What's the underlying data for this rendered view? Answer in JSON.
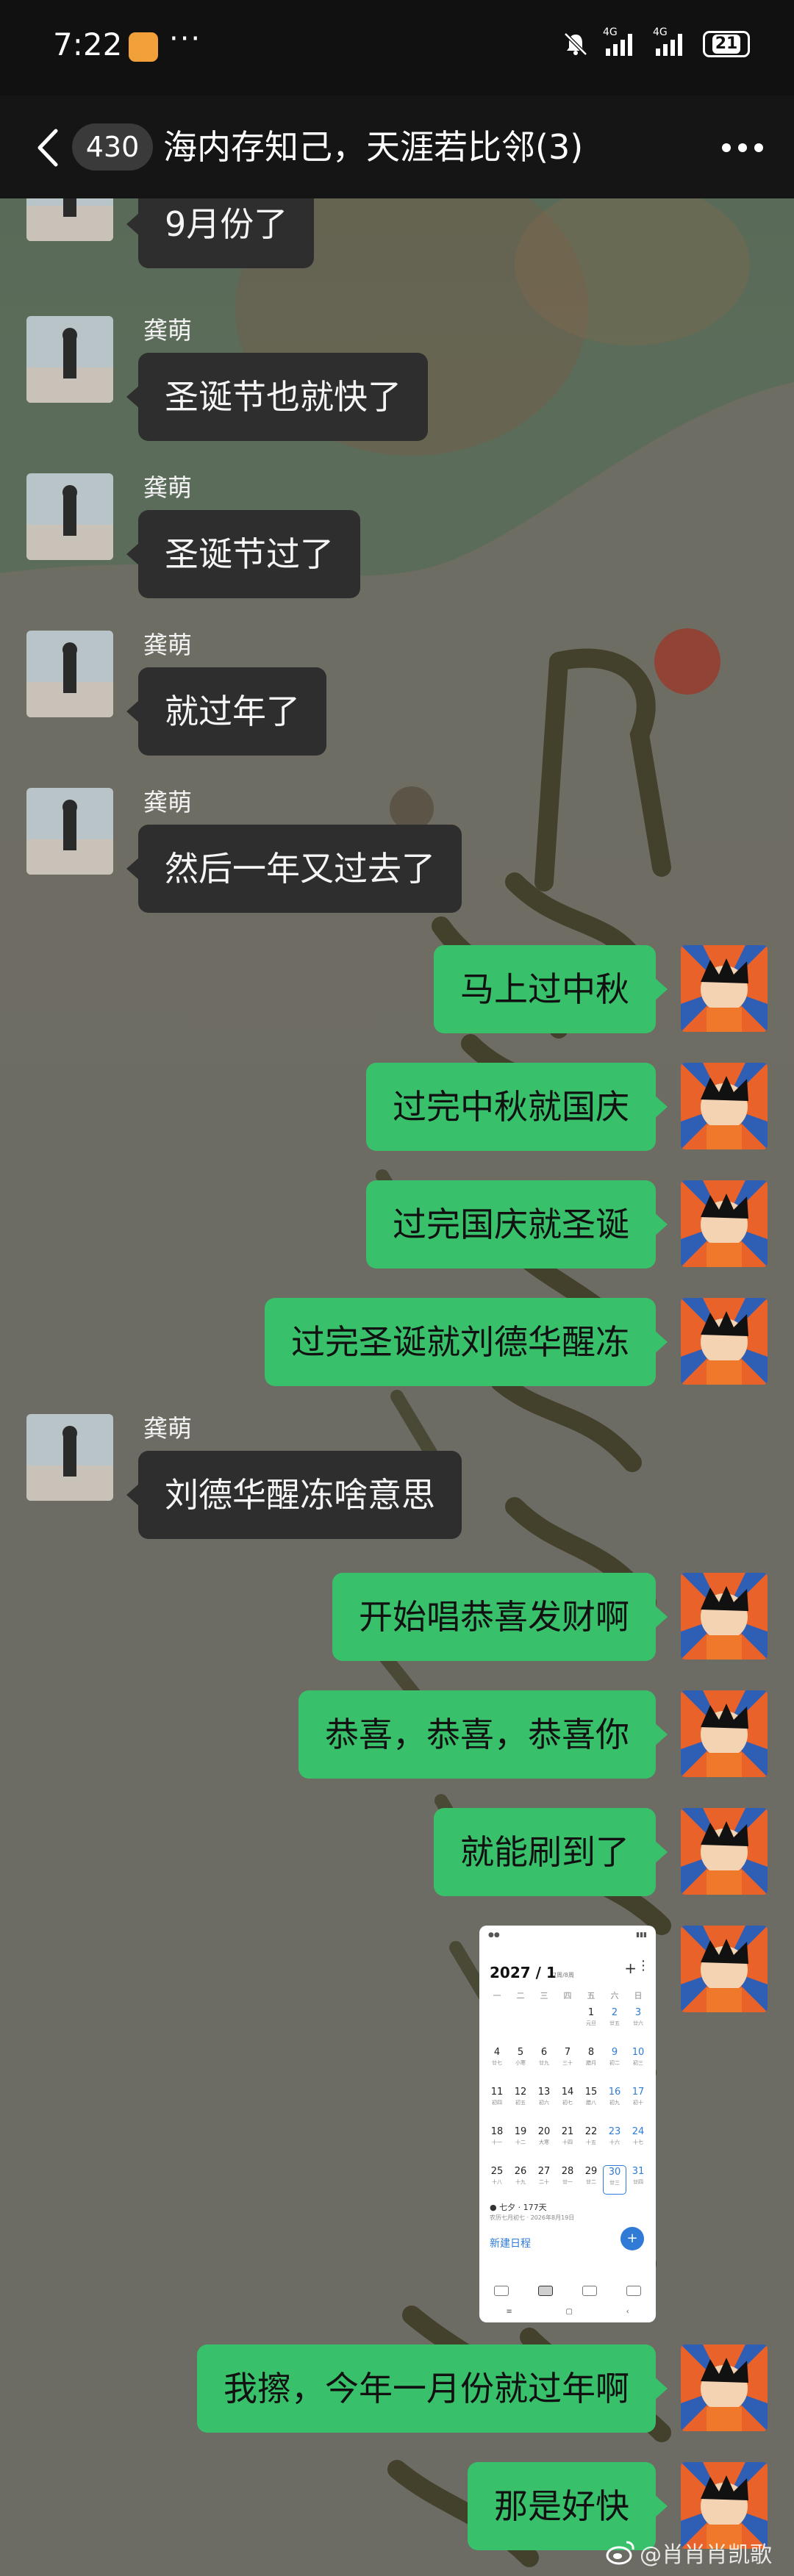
{
  "status_bar": {
    "time": "7:22",
    "more_dots": "···",
    "signal_1_label": "4G",
    "signal_2_label": "4G",
    "battery": "21"
  },
  "nav": {
    "unread_count": "430",
    "title": "海内存知己，天涯若比邻(3)"
  },
  "messages": [
    {
      "side": "in",
      "sender": "",
      "text": "9月份了"
    },
    {
      "side": "in",
      "sender": "龚萌",
      "text": "圣诞节也就快了"
    },
    {
      "side": "in",
      "sender": "龚萌",
      "text": "圣诞节过了"
    },
    {
      "side": "in",
      "sender": "龚萌",
      "text": "就过年了"
    },
    {
      "side": "in",
      "sender": "龚萌",
      "text": "然后一年又过去了"
    },
    {
      "side": "out",
      "text": "马上过中秋"
    },
    {
      "side": "out",
      "text": "过完中秋就国庆"
    },
    {
      "side": "out",
      "text": "过完国庆就圣诞"
    },
    {
      "side": "out",
      "text": "过完圣诞就刘德华醒冻"
    },
    {
      "side": "in",
      "sender": "龚萌",
      "text": "刘德华醒冻啥意思"
    },
    {
      "side": "out",
      "text": "开始唱恭喜发财啊"
    },
    {
      "side": "out",
      "text": "恭喜，恭喜，恭喜你"
    },
    {
      "side": "out",
      "text": "就能刷到了"
    },
    {
      "side": "out",
      "type": "image"
    },
    {
      "side": "out",
      "text": "我擦，今年一月份就过年啊"
    },
    {
      "side": "out",
      "text": "那是好快"
    }
  ],
  "calendar_screenshot": {
    "header": "2027 / 1",
    "header_sub": "7周/8周",
    "weekdays": [
      "一",
      "二",
      "三",
      "四",
      "五",
      "六",
      "日"
    ],
    "days": [
      {
        "d": "",
        "l": ""
      },
      {
        "d": "",
        "l": ""
      },
      {
        "d": "",
        "l": ""
      },
      {
        "d": "",
        "l": ""
      },
      {
        "d": "1",
        "l": "元旦"
      },
      {
        "d": "2",
        "l": "廿五"
      },
      {
        "d": "3",
        "l": "廿六"
      },
      {
        "d": "4",
        "l": "廿七"
      },
      {
        "d": "5",
        "l": "小寒"
      },
      {
        "d": "6",
        "l": "廿九"
      },
      {
        "d": "7",
        "l": "三十"
      },
      {
        "d": "8",
        "l": "腊月"
      },
      {
        "d": "9",
        "l": "初二"
      },
      {
        "d": "10",
        "l": "初三"
      },
      {
        "d": "11",
        "l": "初四"
      },
      {
        "d": "12",
        "l": "初五"
      },
      {
        "d": "13",
        "l": "初六"
      },
      {
        "d": "14",
        "l": "初七"
      },
      {
        "d": "15",
        "l": "腊八"
      },
      {
        "d": "16",
        "l": "初九"
      },
      {
        "d": "17",
        "l": "初十"
      },
      {
        "d": "18",
        "l": "十一"
      },
      {
        "d": "19",
        "l": "十二"
      },
      {
        "d": "20",
        "l": "大寒"
      },
      {
        "d": "21",
        "l": "十四"
      },
      {
        "d": "22",
        "l": "十五"
      },
      {
        "d": "23",
        "l": "十六"
      },
      {
        "d": "24",
        "l": "十七"
      },
      {
        "d": "25",
        "l": "十八"
      },
      {
        "d": "26",
        "l": "十九"
      },
      {
        "d": "27",
        "l": "二十"
      },
      {
        "d": "28",
        "l": "廿一"
      },
      {
        "d": "29",
        "l": "廿二"
      },
      {
        "d": "30",
        "l": "廿三"
      },
      {
        "d": "31",
        "l": "廿四"
      }
    ],
    "event_title": "● 七夕 · 177天",
    "event_sub": "农历七月初七 · 2026年8月19日",
    "event_link": "新建日程"
  },
  "watermark": "@肖肖肖凯歌",
  "colors": {
    "outgoing_bubble": "#38c06b",
    "incoming_bubble": "#2e2e2e",
    "nav_bg": "#151515"
  }
}
